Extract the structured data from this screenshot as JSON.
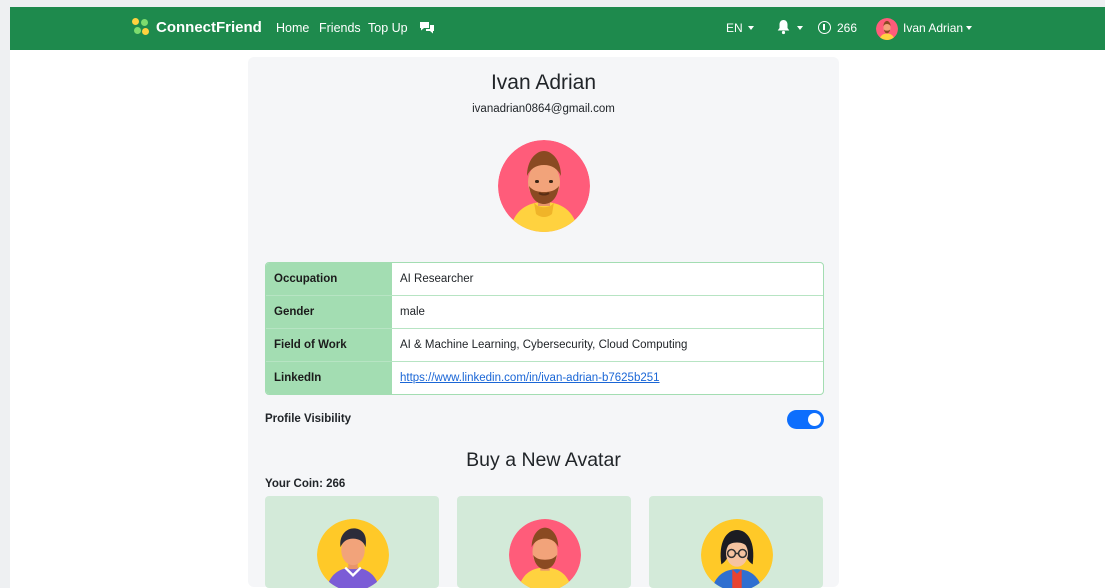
{
  "navbar": {
    "brand": "ConnectFriend",
    "links": [
      "Home",
      "Friends",
      "Top Up"
    ],
    "language": "EN",
    "coins": "266",
    "user_name": "Ivan Adrian"
  },
  "profile": {
    "name": "Ivan Adrian",
    "email": "ivanadrian0864@gmail.com",
    "details": [
      {
        "label": "Occupation",
        "value": "AI Researcher"
      },
      {
        "label": "Gender",
        "value": "male"
      },
      {
        "label": "Field of Work",
        "value": "AI & Machine Learning, Cybersecurity, Cloud Computing"
      },
      {
        "label": "LinkedIn",
        "value": "https://www.linkedin.com/in/ivan-adrian-b7625b251"
      }
    ],
    "visibility_label": "Profile Visibility",
    "visibility_on": true
  },
  "shop": {
    "title": "Buy a New Avatar",
    "coin_text": "Your Coin: 266",
    "avatars": [
      "man-avatar-icon",
      "bearded-man-avatar-icon",
      "woman-glasses-avatar-icon"
    ]
  },
  "colors": {
    "navbar": "#1e8a4d",
    "label_cell": "#a3ddb2",
    "toggle": "#0d6efd",
    "avatar_card": "#d3ead9",
    "link": "#1a66d6"
  }
}
